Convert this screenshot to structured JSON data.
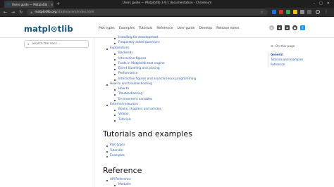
{
  "browser": {
    "tab_title": "Users guide — Matplotlib 3...",
    "tab_close": "×",
    "new_tab": "+",
    "window_title": "Users guide — Matplotlib 3.9.1 documentation - Chromium",
    "window_controls": [
      "–",
      "▢",
      "✕"
    ],
    "nav": {
      "back": "←",
      "forward": "→",
      "reload": "↻"
    },
    "url_host": "matplotlib.org",
    "url_path": "/stable/users/index.html",
    "star": "☆"
  },
  "header": {
    "logo": "matpl⊙tlib",
    "nav_items": [
      "Plot types",
      "Examples",
      "Tutorials",
      "Reference",
      "User guide",
      "Develop",
      "Release notes"
    ],
    "icons": [
      "gitter-icon",
      "discourse-icon",
      "github-icon",
      "twitter-icon"
    ]
  },
  "sidebar": {
    "search_placeholder": "Search the docs ...",
    "search_icon": "🔍"
  },
  "main": {
    "items": [
      {
        "text": "Installing for development",
        "level": 2
      },
      {
        "text": "Frequently asked questions",
        "level": 2
      },
      {
        "text": "Explanations",
        "level": 1
      },
      {
        "text": "Backends",
        "level": 2
      },
      {
        "text": "Interactive figures",
        "level": 2
      },
      {
        "text": "Fonts in Matplotlib text engine",
        "level": 2
      },
      {
        "text": "Event handling and picking",
        "level": 2
      },
      {
        "text": "Performance",
        "level": 2
      },
      {
        "text": "Interactive figures and asynchronous programming",
        "level": 2
      },
      {
        "text": "How-to and troubleshooting",
        "level": 1
      },
      {
        "text": "How-to",
        "level": 2
      },
      {
        "text": "Troubleshooting",
        "level": 2
      },
      {
        "text": "Environment variables",
        "level": 2
      },
      {
        "text": "External resources",
        "level": 1
      },
      {
        "text": "Books, chapters and articles",
        "level": 2
      },
      {
        "text": "Videos",
        "level": 2
      },
      {
        "text": "Tutorials",
        "level": 2
      }
    ],
    "tutorials_heading": "Tutorials and examples",
    "tutorials_items": [
      "Plot types",
      "Tutorials",
      "Examples"
    ],
    "reference_heading": "Reference",
    "reference_items": [
      {
        "text": "API Reference",
        "level": 1
      },
      {
        "text": "Modules",
        "level": 2
      }
    ]
  },
  "right_toc": {
    "title": "On this page",
    "items": [
      "General",
      "Tutorials and examples",
      "Reference"
    ]
  }
}
